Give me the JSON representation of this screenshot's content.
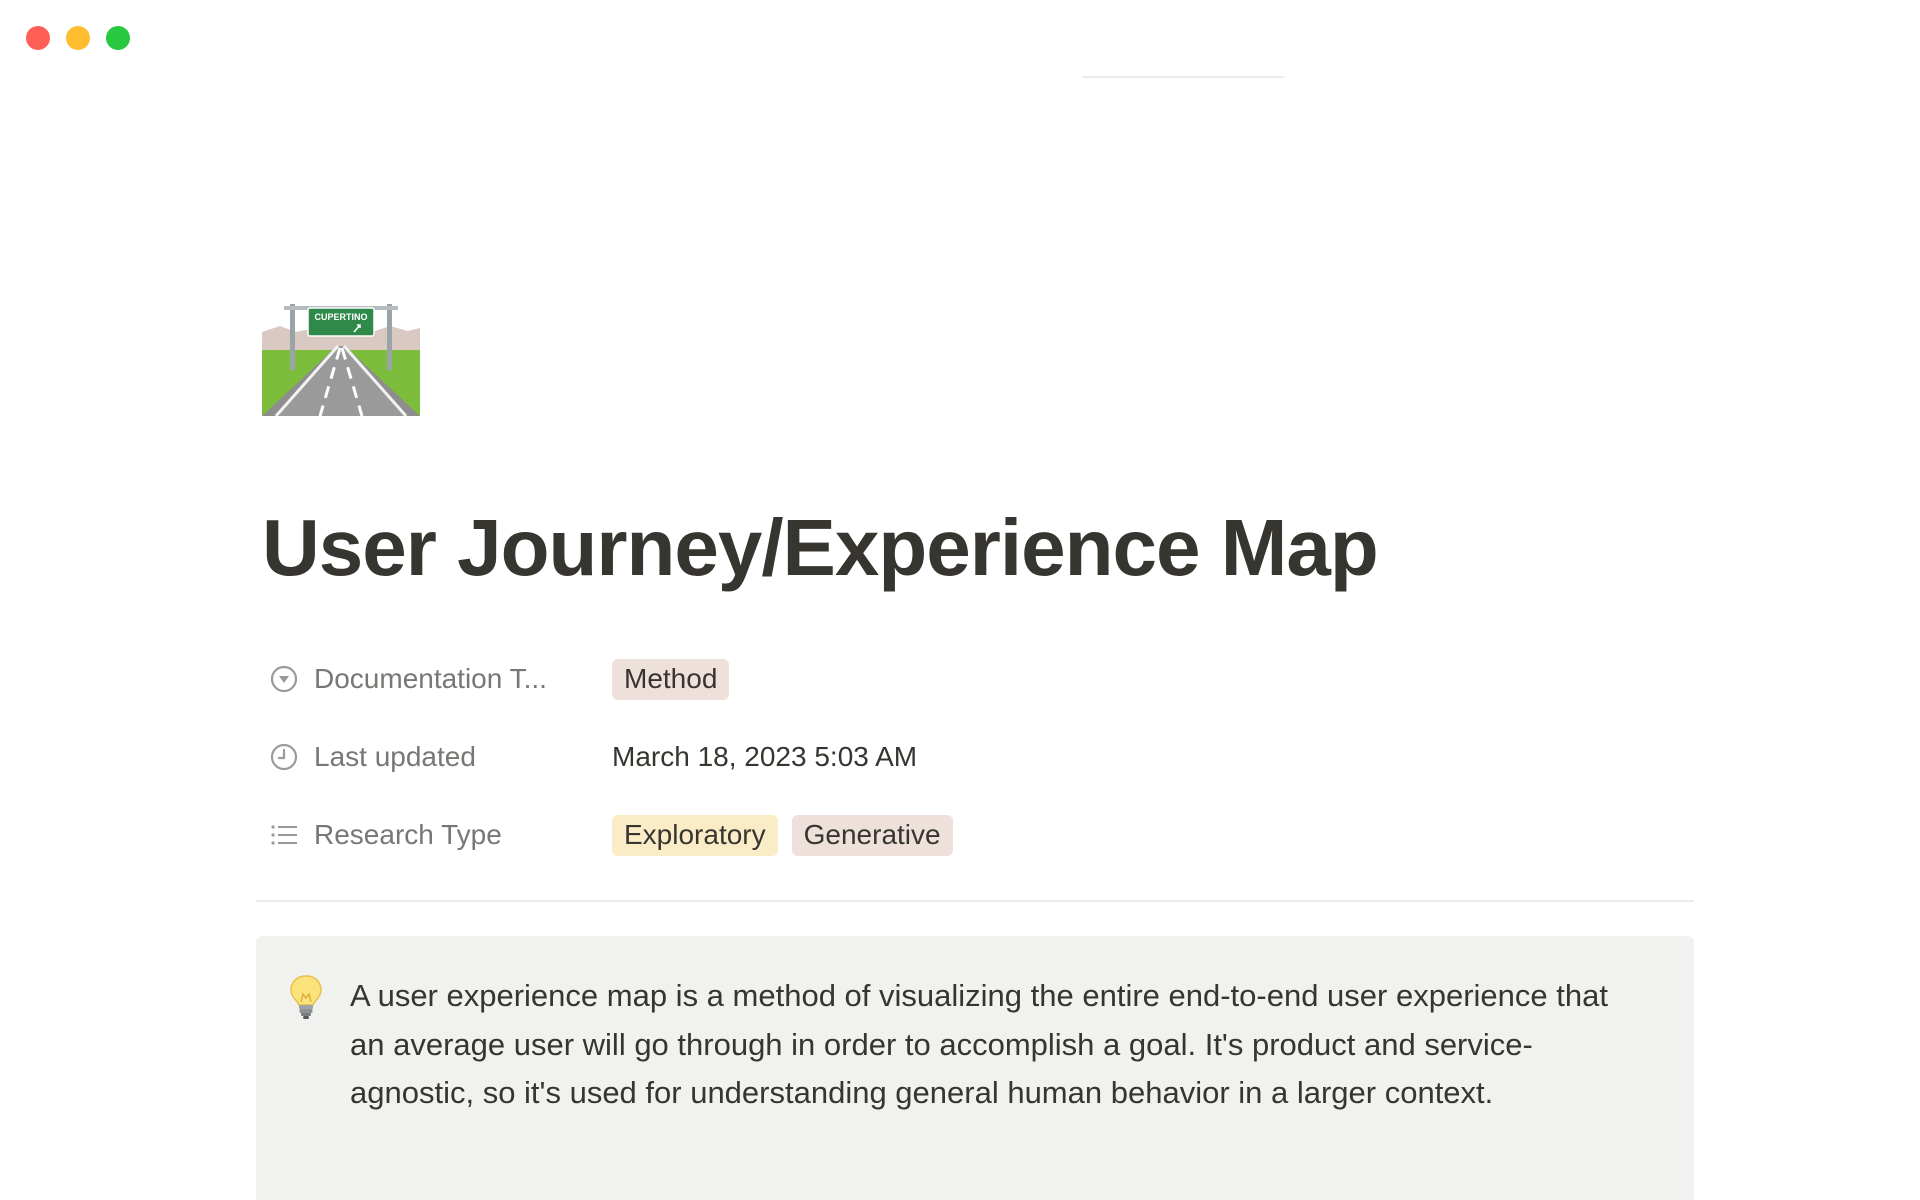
{
  "window": {
    "controls": [
      "close",
      "minimize",
      "maximize"
    ]
  },
  "page": {
    "icon": "highway-road-sign-icon",
    "icon_sign_text": "CUPERTINO",
    "title": "User Journey/Experience Map"
  },
  "properties": [
    {
      "icon": "select-icon",
      "name": "Documentation T...",
      "tags": [
        {
          "label": "Method",
          "color": "#eee0da"
        }
      ]
    },
    {
      "icon": "clock-icon",
      "name": "Last updated",
      "value": "March 18, 2023 5:03 AM"
    },
    {
      "icon": "list-icon",
      "name": "Research Type",
      "tags": [
        {
          "label": "Exploratory",
          "color": "#fbecc8"
        },
        {
          "label": "Generative",
          "color": "#eee0da"
        }
      ]
    }
  ],
  "callout": {
    "icon": "lightbulb-icon",
    "text": "A user experience map is a method of visualizing the entire end-to-end user experience that an average user will go through in order to accomplish a goal. It's product and service-agnostic, so it's used for understanding general human behavior in a larger context."
  }
}
